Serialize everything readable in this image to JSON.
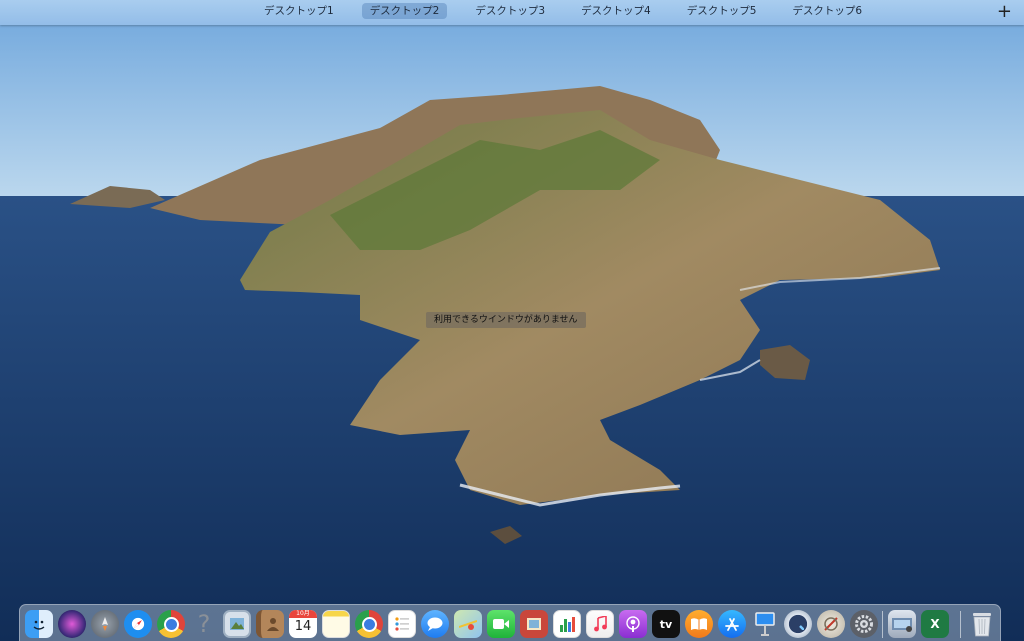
{
  "spaces": {
    "tabs": [
      "デスクトップ1",
      "デスクトップ2",
      "デスクトップ3",
      "デスクトップ4",
      "デスクトップ5",
      "デスクトップ6"
    ],
    "active_index": 1,
    "add_symbol": "+"
  },
  "empty_message": "利用できるウインドウがありません",
  "calendar": {
    "month": "10月",
    "day": "14"
  },
  "help_symbol": "?",
  "excel_letter": "X",
  "tv_label": "tv",
  "colors": {
    "bar": "#a9cdef",
    "sky": "#8fbbe6",
    "sea": "#1d3f70"
  },
  "dock": {
    "apps": [
      "finder-icon",
      "siri-icon",
      "launchpad-icon",
      "safari-icon",
      "chrome-icon",
      "help-icon",
      "preview-icon",
      "contacts-icon",
      "calendar-icon",
      "notes-icon",
      "chrome-icon",
      "reminders-icon",
      "messages-icon",
      "maps-icon",
      "facetime-icon",
      "photo-booth-icon",
      "numbers-icon",
      "music-icon",
      "podcasts-icon",
      "apple-tv-icon",
      "books-icon",
      "app-store-icon",
      "keynote-icon",
      "quicktime-icon",
      "disk-utility-icon",
      "system-preferences-icon",
      "image-capture-icon",
      "excel-icon",
      "trash-icon"
    ]
  }
}
